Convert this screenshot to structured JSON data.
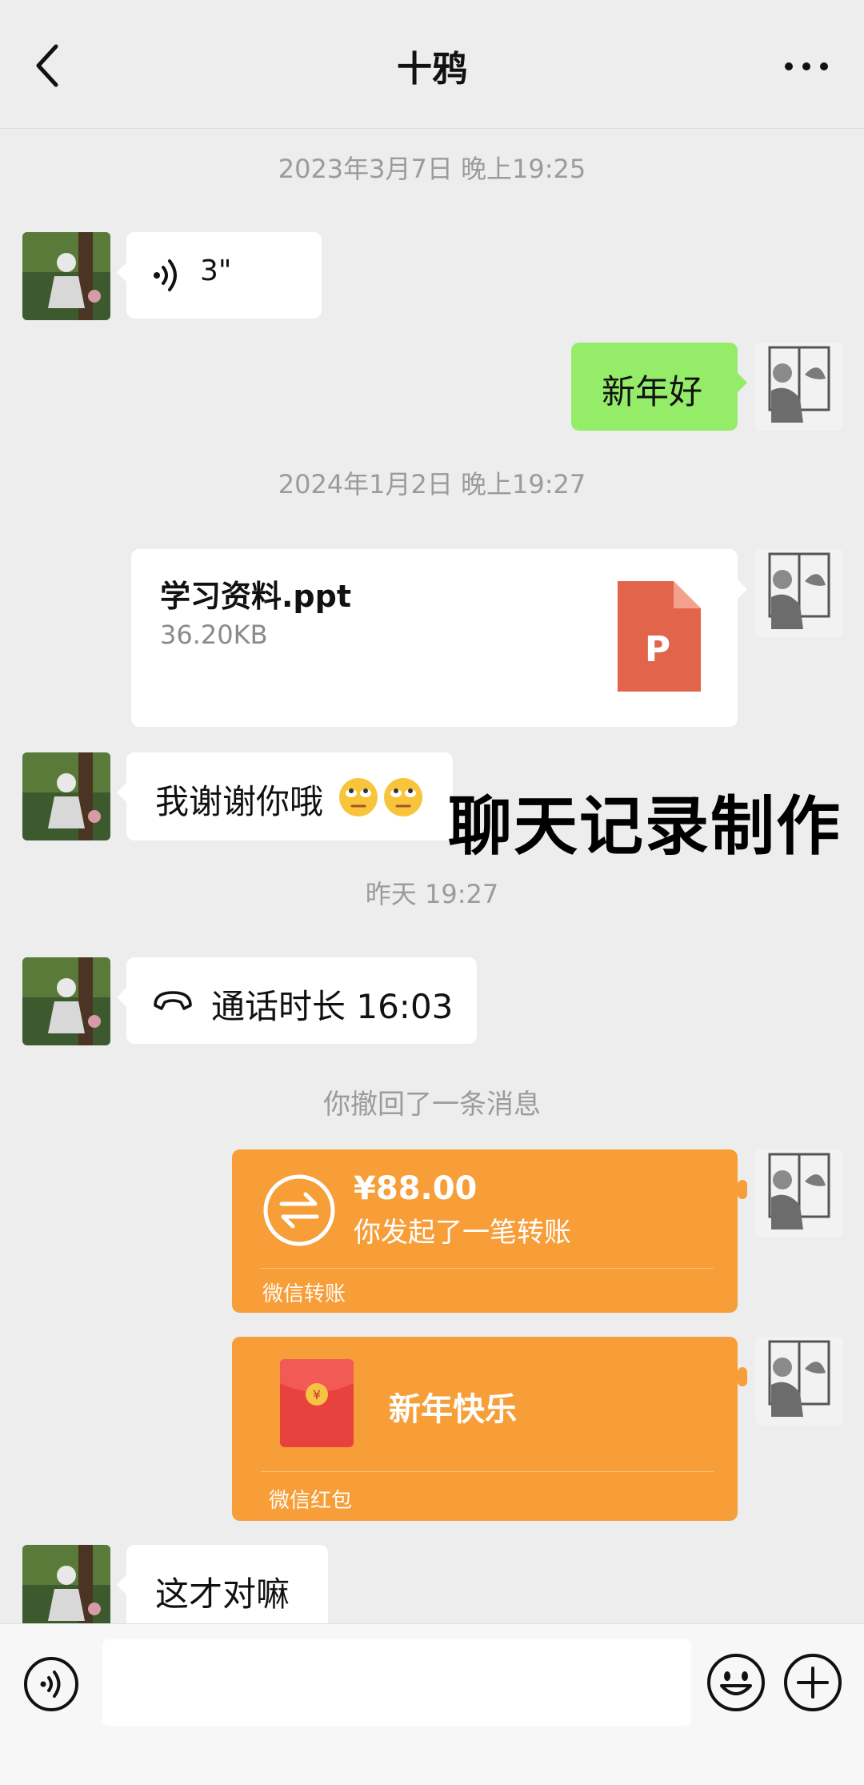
{
  "header": {
    "title": "十鸦",
    "back_icon": "chevron-left-icon",
    "more_icon": "more-icon"
  },
  "timestamps": {
    "t1": "2023年3月7日 晚上19:25",
    "t2": "2024年1月2日 晚上19:27",
    "t3": "昨天 19:27"
  },
  "messages": {
    "voice_duration": "3\"",
    "greet": "新年好",
    "file": {
      "name": "学习资料.ppt",
      "size": "36.20KB",
      "icon": "ppt-file-icon",
      "icon_letter": "P"
    },
    "thanks": "我谢谢你哦",
    "thanks_emojis": [
      "eye-roll-emoji",
      "eye-roll-emoji"
    ],
    "call": "通话时长 16:03",
    "recalled": "你撤回了一条消息",
    "transfer": {
      "amount": "¥88.00",
      "desc": "你发起了一笔转账",
      "footer": "微信转账"
    },
    "red_packet": {
      "text": "新年快乐",
      "footer": "微信红包"
    },
    "last": "这才对嘛"
  },
  "watermark": "聊天记录制作",
  "input_bar": {
    "voice_icon": "voice-input-icon",
    "emoji_icon": "emoji-icon",
    "add_icon": "plus-icon"
  },
  "colors": {
    "background": "#EDEDED",
    "green_bubble": "#95EC69",
    "orange_card": "#F79E39",
    "ppt_icon": "#E2654B"
  }
}
